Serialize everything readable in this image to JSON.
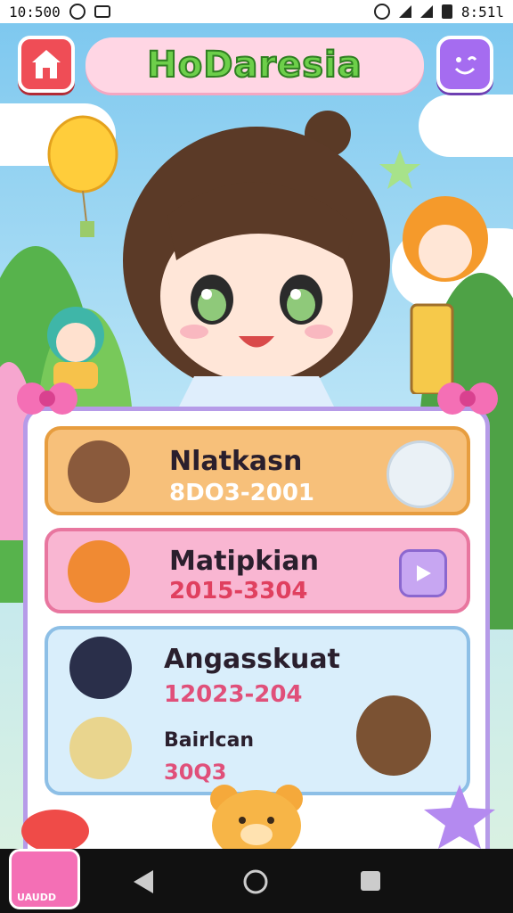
{
  "statusbar": {
    "time_left": "10:500",
    "time_right": "8:51l"
  },
  "header": {
    "title": "HoDaresia"
  },
  "cards": [
    {
      "name": "Nlatkasn",
      "date": "8DO3-2001",
      "accent": "#f7c07a"
    },
    {
      "name": "Matipkian",
      "date": "2015-3304",
      "accent": "#f9b6d2"
    },
    {
      "name": "Angasskuat",
      "date": "12023-204",
      "accent": "#b9dcf4"
    },
    {
      "name": "Bairlcan",
      "date": "30Q3",
      "accent": "#b9dcf4"
    }
  ],
  "dock": {
    "app_label": "UAUDD"
  },
  "colors": {
    "title_green": "#6dcf4a",
    "home_red": "#ef4d56",
    "face_purple": "#a56cf0",
    "panel_border": "#b69be8"
  }
}
